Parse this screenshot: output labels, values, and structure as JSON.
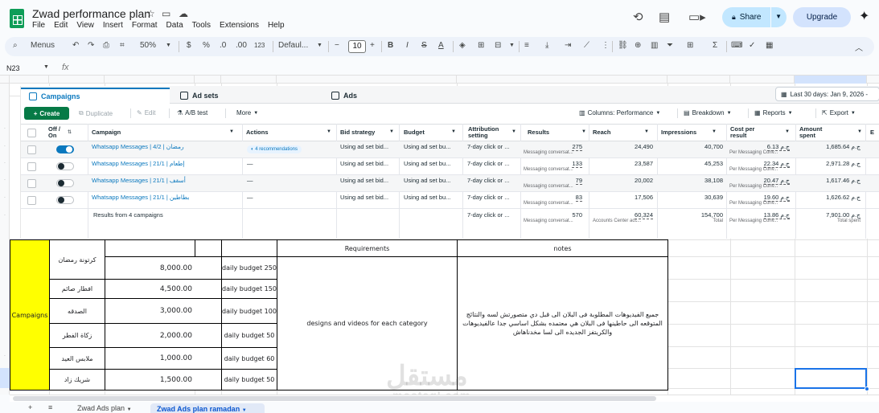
{
  "app": {
    "doc_title": "Zwad performance plan",
    "menu": [
      "File",
      "Edit",
      "View",
      "Insert",
      "Format",
      "Data",
      "Tools",
      "Extensions",
      "Help"
    ],
    "share_label": "Share",
    "upgrade_label": "Upgrade"
  },
  "toolbar": {
    "menus_label": "Menus",
    "zoom": "50%",
    "currency": "$",
    "percent": "%",
    "dec_dec": ".0",
    "dec_inc": ".00",
    "num_format": "123",
    "font": "Defaul...",
    "font_size": "10"
  },
  "formula_bar": {
    "cell_ref": "N23",
    "fx": "fx"
  },
  "ads_manager": {
    "tabs": [
      "Campaigns",
      "Ad sets",
      "Ads"
    ],
    "date_range": "Last 30 days: Jan 9, 2026 -",
    "actions": {
      "create": "Create",
      "duplicate": "Duplicate",
      "edit": "Edit",
      "ab_test": "A/B test",
      "more": "More",
      "columns": "Columns: Performance",
      "breakdown": "Breakdown",
      "reports": "Reports",
      "export": "Export"
    },
    "columns": {
      "off_on": "Off / On",
      "campaign": "Campaign",
      "actions": "Actions",
      "bid_strategy": "Bid strategy",
      "budget": "Budget",
      "attribution": "Attribution setting",
      "results": "Results",
      "reach": "Reach",
      "impressions": "Impressions",
      "cost_per_result": "Cost per result",
      "amount_spent": "Amount spent",
      "extra": "E"
    },
    "rows": [
      {
        "on": true,
        "campaign": "Whatsapp Messages | 4/2 | رمضان",
        "actions": "4 recommendations",
        "bid": "Using ad set bid...",
        "budget": "Using ad set bu...",
        "attribution": "7-day click or ...",
        "results": "275",
        "results_sub": "Messaging conversat...",
        "reach": "24,490",
        "impressions": "40,700",
        "cpr": "6.13 ج.م",
        "cpr_sub": "Per Messaging Conv...",
        "spent": "1,685.64 ج.م"
      },
      {
        "on": false,
        "campaign": "Whatsapp Messages | 21/1 | إطعام",
        "actions": "—",
        "bid": "Using ad set bid...",
        "budget": "Using ad set bu...",
        "attribution": "7-day click or ...",
        "results": "133",
        "results_sub": "Messaging conversat...",
        "reach": "23,587",
        "impressions": "45,253",
        "cpr": "22.34 ج.م",
        "cpr_sub": "Per Messaging Conv...",
        "spent": "2,971.28 ج.م"
      },
      {
        "on": false,
        "campaign": "Whatsapp Messages | 21/1 | أسقف",
        "actions": "—",
        "bid": "Using ad set bid...",
        "budget": "Using ad set bu...",
        "attribution": "7-day click or ...",
        "results": "79",
        "results_sub": "Messaging conversat...",
        "reach": "20,002",
        "impressions": "38,108",
        "cpr": "20.47 ج.م",
        "cpr_sub": "Per Messaging Conv...",
        "spent": "1,617.46 ج.م"
      },
      {
        "on": false,
        "campaign": "Whatsapp Messages | 21/1 | بطاطين",
        "actions": "—",
        "bid": "Using ad set bid...",
        "budget": "Using ad set bu...",
        "attribution": "7-day click or ...",
        "results": "83",
        "results_sub": "Messaging conversat...",
        "reach": "17,506",
        "impressions": "30,639",
        "cpr": "19.60 ج.م",
        "cpr_sub": "Per Messaging Conv...",
        "spent": "1,626.62 ج.م"
      }
    ],
    "totals": {
      "label": "Results from 4 campaigns",
      "attribution": "7-day click or ...",
      "results": "570",
      "results_sub": "Messaging conversat...",
      "reach": "60,324",
      "reach_sub": "Accounts Center acc...",
      "impressions": "154,700",
      "impressions_sub": "Total",
      "cpr": "13.86 ج.م",
      "cpr_sub": "Per Messaging Conv...",
      "spent": "7,901.00 ج.م",
      "spent_sub": "Total spent"
    }
  },
  "plan_table": {
    "section_label": "Campaigns",
    "requirements_header": "Requirements",
    "notes_header": "notes",
    "requirements_text": "designs and videos for each category",
    "notes_text": "جميع الفيديوهات المطلوبة فى البلان الى قبل دي متصورتش لسه والنتائج المتوقعه الى حاطينها فى البلان هي معتمده بشكل اساسي جدا عالفيديوهات والكريتفز الجديده الى لسا مخدناهاش",
    "rows": [
      {
        "name": "كرتونة رمضان",
        "amount": "8,000.00",
        "daily": "daily budget 250"
      },
      {
        "name": "افطار صائم",
        "amount": "4,500.00",
        "daily": "daily budget 150"
      },
      {
        "name": "الصدقه",
        "amount": "3,000.00",
        "daily": "daily budget 100"
      },
      {
        "name": "زكاة الفطر",
        "amount": "2,000.00",
        "daily": "daily budget 50"
      },
      {
        "name": "ملابس العيد",
        "amount": "1,000.00",
        "daily": "daily budget 60"
      },
      {
        "name": "شريك زاد",
        "amount": "1,500.00",
        "daily": "daily budget 50"
      }
    ]
  },
  "sheet_tabs": [
    "Zwad Ads plan",
    "Zwad Ads plan ramadan"
  ],
  "watermark": {
    "arabic": "مستقل",
    "latin": "mostaql.com"
  },
  "colors": {
    "accent": "#0b57d0",
    "yellow": "#ffff00",
    "create_green": "#067a46",
    "meta_blue": "#0a78be"
  }
}
